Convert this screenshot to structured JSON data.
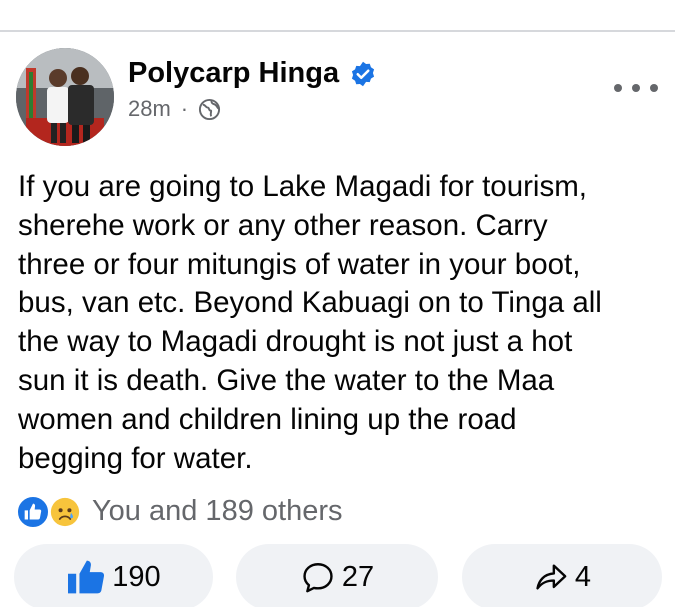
{
  "post": {
    "author": "Polycarp Hinga",
    "time": "28m",
    "separator": "·",
    "audience_icon": "globe-icon",
    "verified_icon": "verified-badge-icon",
    "more_icon": "more-options-icon",
    "text": "If you are going to Lake Magadi for tourism,\nsherehe work or any other reason. Carry\nthree or four mitungis of water in your boot,\nbus, van etc. Beyond Kabuagi on to Tinga all\nthe way to Magadi drought is not just a hot\nsun it is death. Give the water  to the Maa\nwomen and children lining up the road\nbegging for water."
  },
  "reactions": {
    "icons": [
      "like-reaction-icon",
      "sad-reaction-icon"
    ],
    "summary": "You and 189 others"
  },
  "actions": {
    "like_count": "190",
    "comment_count": "27",
    "share_count": "4"
  },
  "colors": {
    "brand_blue": "#1b74e4",
    "secondary_text": "#65676b",
    "button_bg": "#f0f2f5",
    "sad_yellow": "#f7c43c"
  }
}
